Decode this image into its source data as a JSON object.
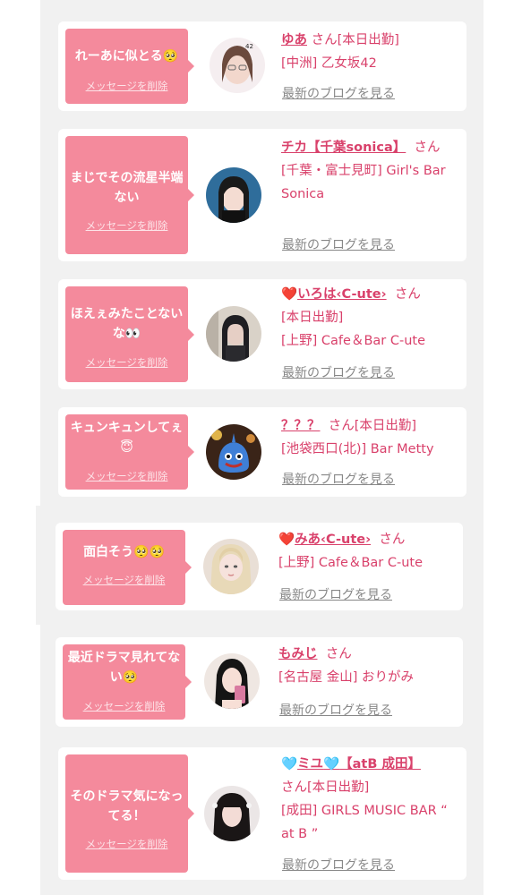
{
  "delete_label": "メッセージを削除",
  "blog_label": "最新のブログを見る",
  "honorific": "さん",
  "cards": [
    {
      "message": "れーあに似とる🥺",
      "name": "ゆあ",
      "status": "[本日出勤]",
      "shop": "[中洲] 乙女坂42"
    },
    {
      "message": "まじでその流星半端ない",
      "name": "チカ【千葉sonica】",
      "status": "",
      "shop": "[千葉・富士見町] Girl's Bar Sonica"
    },
    {
      "message": "ほえぇみたことないな👀",
      "name": "いろは‹C-ute›",
      "name_icon": "❤️",
      "status": "[本日出勤]",
      "shop": "[上野] Cafe＆Bar C-ute"
    },
    {
      "message": "キュンキュンしてぇ😇",
      "name": "？？？",
      "status": "[本日出勤]",
      "shop": "[池袋西口(北)] Bar Metty"
    },
    {
      "message": "面白そう🥺🥺",
      "name": "みあ‹C-ute›",
      "name_icon": "❤️",
      "status": "",
      "shop": "[上野] Cafe＆Bar C-ute"
    },
    {
      "message": "最近ドラマ見れてない🥺",
      "name": "もみじ",
      "status": "",
      "shop": "[名古屋 金山] おりがみ"
    },
    {
      "message": "そのドラマ気になってる！",
      "name": "ミユ",
      "name_icon": "🩵",
      "name_suffix": "【atB 成田】",
      "status": "[本日出勤]",
      "shop": "[成田] GIRLS MUSIC BAR “ at B ”"
    }
  ]
}
